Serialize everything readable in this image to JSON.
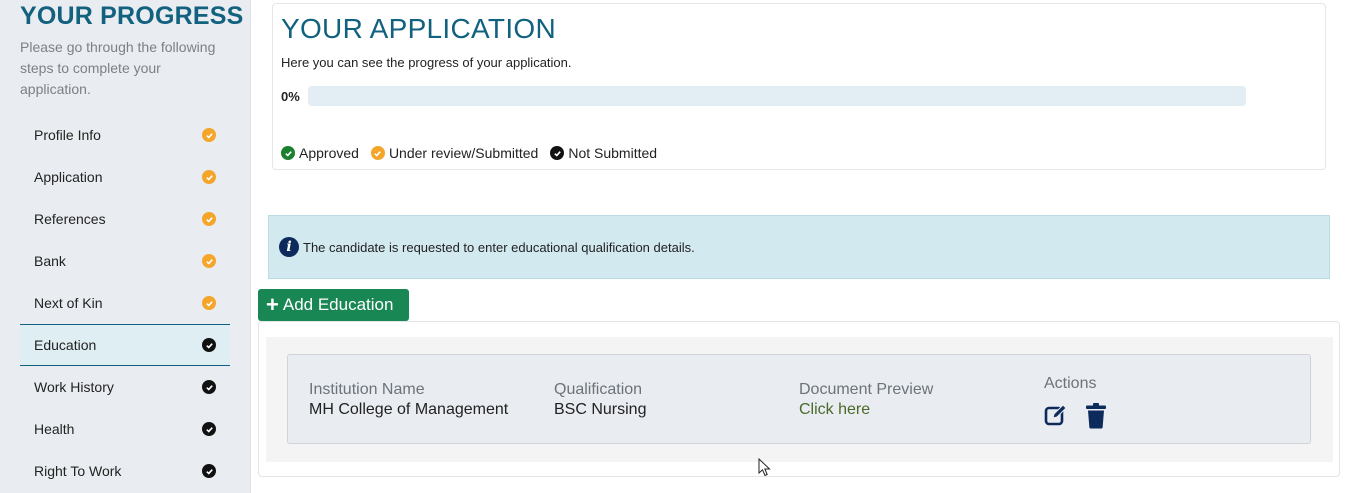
{
  "sidebar": {
    "title": "YOUR PROGRESS",
    "intro": "Please go through the following steps to complete your application.",
    "steps": [
      {
        "label": "Profile Info",
        "status": "under-review",
        "icon": "check-circle-icon"
      },
      {
        "label": "Application",
        "status": "under-review",
        "icon": "check-circle-icon"
      },
      {
        "label": "References",
        "status": "under-review",
        "icon": "check-circle-icon"
      },
      {
        "label": "Bank",
        "status": "under-review",
        "icon": "check-circle-icon"
      },
      {
        "label": "Next of Kin",
        "status": "under-review",
        "icon": "check-circle-icon"
      },
      {
        "label": "Education",
        "status": "not-submitted",
        "icon": "check-circle-icon",
        "active": true
      },
      {
        "label": "Work History",
        "status": "not-submitted",
        "icon": "check-circle-icon"
      },
      {
        "label": "Health",
        "status": "not-submitted",
        "icon": "check-circle-icon"
      },
      {
        "label": "Right To Work",
        "status": "not-submitted",
        "icon": "check-circle-icon"
      }
    ]
  },
  "application": {
    "title": "YOUR APPLICATION",
    "subtitle": "Here you can see the progress of your application.",
    "progress_label": "0%",
    "progress_value": 0,
    "legend": [
      {
        "label": "Approved",
        "color": "#1a7f2e"
      },
      {
        "label": "Under review/Submitted",
        "color": "#f4a52a"
      },
      {
        "label": "Not Submitted",
        "color": "#111111"
      }
    ]
  },
  "alert": {
    "icon": "info-icon",
    "text": "The candidate is requested to enter educational qualification details."
  },
  "add_button": {
    "label": "Add Education",
    "icon": "plus-icon",
    "color": "#198754"
  },
  "education": {
    "headers": {
      "institution": "Institution Name",
      "qualification": "Qualification",
      "document": "Document Preview",
      "actions": "Actions"
    },
    "rows": [
      {
        "institution": "MH College of Management",
        "qualification": "BSC Nursing",
        "document_link": "Click here"
      }
    ]
  },
  "colors": {
    "brand": "#12617f",
    "under_review": "#f4a52a",
    "not_submitted": "#111111",
    "approved": "#1a7f2e"
  }
}
